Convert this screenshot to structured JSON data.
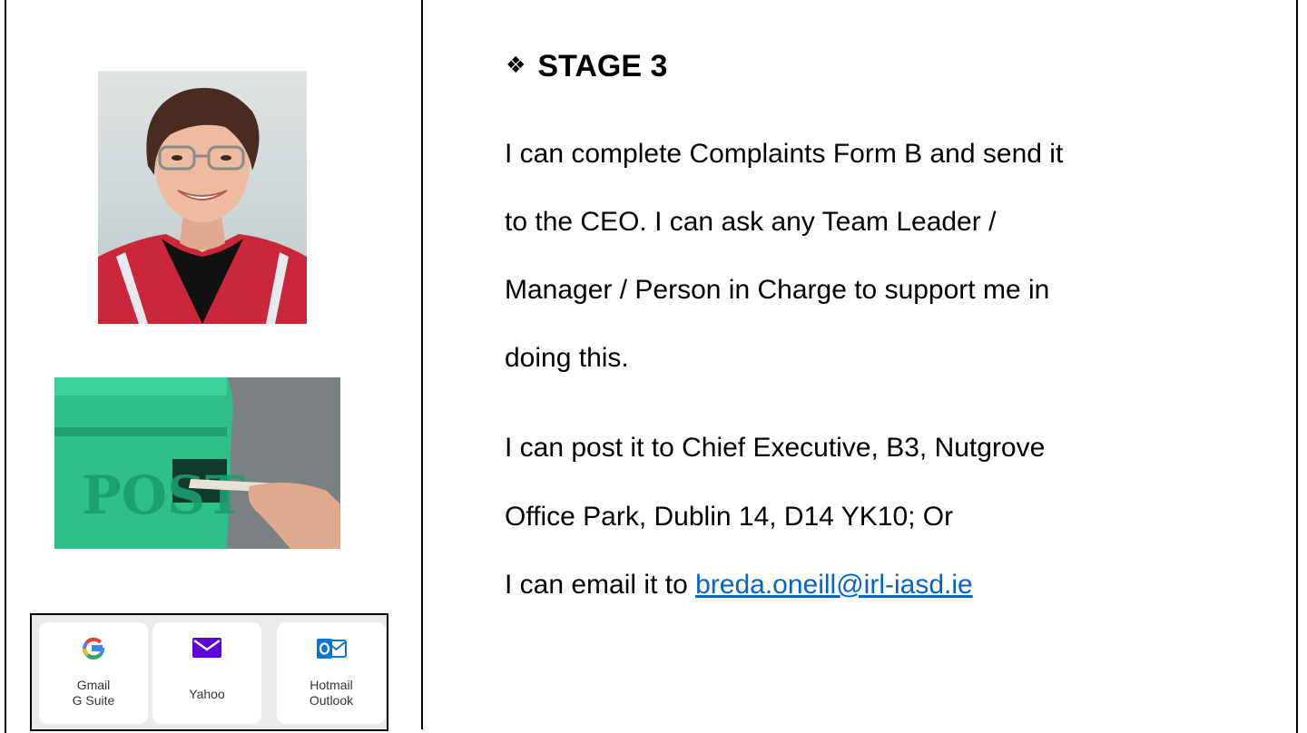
{
  "heading": {
    "icon": "four-diamond-bullet-icon",
    "text": "STAGE 3"
  },
  "paragraph1": [
    "I can complete Complaints Form B and send it",
    "to the CEO.  I can ask any Team Leader /",
    "Manager / Person in Charge to support me in",
    "doing this."
  ],
  "paragraph2": [
    "I can post it to Chief Executive, B3, Nutgrove",
    "Office Park, Dublin 14, D14 YK10; Or"
  ],
  "email_line": {
    "prefix": "I can email it to ",
    "link": "breda.oneill@irl-iasd.ie"
  },
  "email_options": [
    {
      "icon": "google-g-icon",
      "label1": "Gmail",
      "label2": "G Suite"
    },
    {
      "icon": "yahoo-envelope-icon",
      "label1": "Yahoo",
      "label2": ""
    },
    {
      "icon": "outlook-icon",
      "label1": "Hotmail",
      "label2": "Outlook"
    }
  ],
  "colors": {
    "link": "#0563c1",
    "yahoo": "#5f01d1",
    "outlook": "#0078d4",
    "postbox_green": "#2fbf8a"
  },
  "post_box_lettering": "POST"
}
